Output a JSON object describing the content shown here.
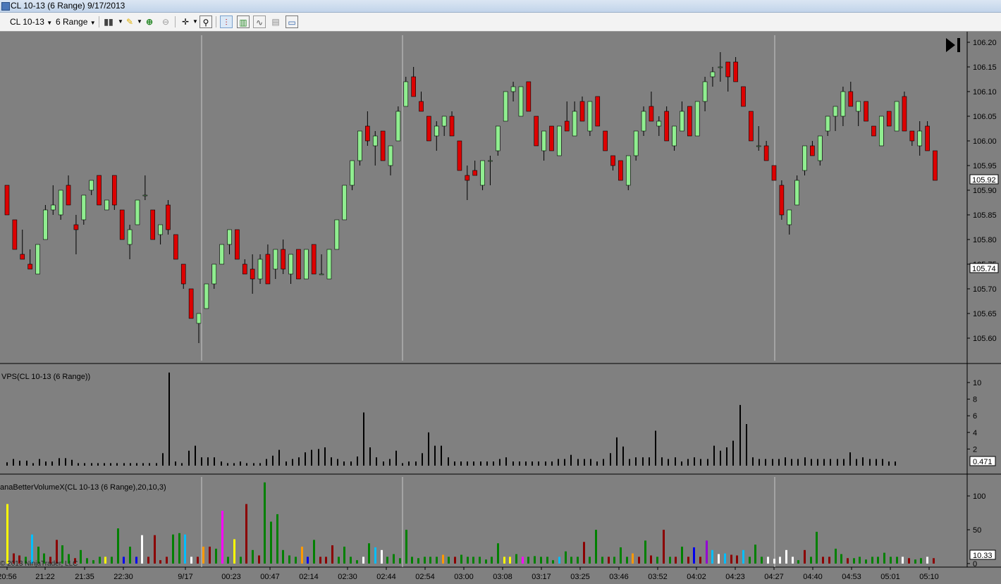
{
  "window": {
    "title": "CL 10-13 (6 Range)  9/17/2013"
  },
  "toolbar": {
    "instrument": "CL 10-13",
    "interval": "6 Range",
    "icons": [
      "bar-type-icon",
      "pencil-draw-icon",
      "zoom-in-icon",
      "zoom-out-icon",
      "crosshair-icon",
      "magnifier-icon",
      "bars-icon",
      "candles-icon",
      "line-chart-icon",
      "data-box-icon",
      "properties-icon"
    ]
  },
  "panels": {
    "price": {
      "y_labels": [
        "106.20",
        "106.15",
        "106.10",
        "106.05",
        "106.00",
        "105.95",
        "105.90",
        "105.85",
        "105.80",
        "105.75",
        "105.70",
        "105.65",
        "105.60"
      ],
      "last_price": "105.92",
      "marker_price": "105.74"
    },
    "vps": {
      "label": "VPS(CL 10-13 (6 Range))",
      "y_labels": [
        "10",
        "8",
        "6",
        "4",
        "2"
      ],
      "last_value": "0.471"
    },
    "bvx": {
      "label": "anaBetterVolumeX(CL 10-13 (6 Range),20,10,3)",
      "y_labels": [
        "100",
        "50",
        "0"
      ],
      "last_value": "10.33"
    }
  },
  "x_labels": [
    "20:56",
    "21:22",
    "21:35",
    "22:30",
    "9/17",
    "00:23",
    "00:47",
    "02:14",
    "02:30",
    "02:44",
    "02:54",
    "03:00",
    "03:08",
    "03:17",
    "03:25",
    "03:46",
    "03:52",
    "04:02",
    "04:23",
    "04:27",
    "04:40",
    "04:53",
    "05:01",
    "05:10"
  ],
  "copyright": "© 2013 NinjaTrader, LLC",
  "colors": {
    "up": "#90ee90",
    "down": "#dd0000",
    "background": "#808080"
  },
  "chart_data": {
    "type": "candlestick",
    "ylim": [
      105.55,
      106.23
    ],
    "candles": [
      {
        "o": 105.91,
        "h": 105.91,
        "l": 105.85,
        "c": 105.85
      },
      {
        "o": 105.84,
        "h": 105.84,
        "l": 105.78,
        "c": 105.78
      },
      {
        "o": 105.77,
        "h": 105.82,
        "l": 105.76,
        "c": 105.76
      },
      {
        "o": 105.75,
        "h": 105.78,
        "l": 105.74,
        "c": 105.74
      },
      {
        "o": 105.73,
        "h": 105.79,
        "l": 105.73,
        "c": 105.79
      },
      {
        "o": 105.8,
        "h": 105.87,
        "l": 105.8,
        "c": 105.86
      },
      {
        "o": 105.86,
        "h": 105.91,
        "l": 105.85,
        "c": 105.87
      },
      {
        "o": 105.85,
        "h": 105.9,
        "l": 105.84,
        "c": 105.9
      },
      {
        "o": 105.91,
        "h": 105.93,
        "l": 105.87,
        "c": 105.87
      },
      {
        "o": 105.83,
        "h": 105.85,
        "l": 105.77,
        "c": 105.82
      },
      {
        "o": 105.84,
        "h": 105.89,
        "l": 105.83,
        "c": 105.89
      },
      {
        "o": 105.9,
        "h": 105.92,
        "l": 105.89,
        "c": 105.92
      },
      {
        "o": 105.93,
        "h": 105.93,
        "l": 105.87,
        "c": 105.87
      },
      {
        "o": 105.86,
        "h": 105.88,
        "l": 105.86,
        "c": 105.88
      },
      {
        "o": 105.93,
        "h": 105.93,
        "l": 105.86,
        "c": 105.87
      },
      {
        "o": 105.86,
        "h": 105.86,
        "l": 105.8,
        "c": 105.8
      },
      {
        "o": 105.79,
        "h": 105.83,
        "l": 105.76,
        "c": 105.82
      },
      {
        "o": 105.83,
        "h": 105.88,
        "l": 105.83,
        "c": 105.88
      },
      {
        "o": 105.89,
        "h": 105.93,
        "l": 105.88,
        "c": 105.89
      },
      {
        "o": 105.86,
        "h": 105.86,
        "l": 105.8,
        "c": 105.8
      },
      {
        "o": 105.81,
        "h": 105.83,
        "l": 105.79,
        "c": 105.83
      },
      {
        "o": 105.87,
        "h": 105.88,
        "l": 105.81,
        "c": 105.82
      },
      {
        "o": 105.81,
        "h": 105.81,
        "l": 105.76,
        "c": 105.76
      },
      {
        "o": 105.75,
        "h": 105.75,
        "l": 105.7,
        "c": 105.71
      },
      {
        "o": 105.7,
        "h": 105.7,
        "l": 105.64,
        "c": 105.64
      },
      {
        "o": 105.63,
        "h": 105.65,
        "l": 105.59,
        "c": 105.65
      },
      {
        "o": 105.66,
        "h": 105.71,
        "l": 105.66,
        "c": 105.71
      },
      {
        "o": 105.71,
        "h": 105.75,
        "l": 105.7,
        "c": 105.75
      },
      {
        "o": 105.75,
        "h": 105.79,
        "l": 105.75,
        "c": 105.79
      },
      {
        "o": 105.79,
        "h": 105.82,
        "l": 105.77,
        "c": 105.82
      },
      {
        "o": 105.82,
        "h": 105.82,
        "l": 105.76,
        "c": 105.76
      },
      {
        "o": 105.75,
        "h": 105.76,
        "l": 105.73,
        "c": 105.73
      },
      {
        "o": 105.74,
        "h": 105.77,
        "l": 105.69,
        "c": 105.72
      },
      {
        "o": 105.72,
        "h": 105.77,
        "l": 105.71,
        "c": 105.76
      },
      {
        "o": 105.77,
        "h": 105.79,
        "l": 105.71,
        "c": 105.71
      },
      {
        "o": 105.74,
        "h": 105.78,
        "l": 105.72,
        "c": 105.78
      },
      {
        "o": 105.78,
        "h": 105.8,
        "l": 105.73,
        "c": 105.74
      },
      {
        "o": 105.73,
        "h": 105.77,
        "l": 105.71,
        "c": 105.77
      },
      {
        "o": 105.78,
        "h": 105.78,
        "l": 105.72,
        "c": 105.72
      },
      {
        "o": 105.72,
        "h": 105.78,
        "l": 105.72,
        "c": 105.78
      },
      {
        "o": 105.79,
        "h": 105.79,
        "l": 105.73,
        "c": 105.73
      },
      {
        "o": 105.73,
        "h": 105.77,
        "l": 105.73,
        "c": 105.73
      },
      {
        "o": 105.72,
        "h": 105.78,
        "l": 105.72,
        "c": 105.78
      },
      {
        "o": 105.78,
        "h": 105.84,
        "l": 105.78,
        "c": 105.84
      },
      {
        "o": 105.84,
        "h": 105.91,
        "l": 105.84,
        "c": 105.91
      },
      {
        "o": 105.91,
        "h": 105.96,
        "l": 105.9,
        "c": 105.96
      },
      {
        "o": 105.96,
        "h": 106.02,
        "l": 105.95,
        "c": 106.02
      },
      {
        "o": 106.03,
        "h": 106.06,
        "l": 105.99,
        "c": 106.0
      },
      {
        "o": 105.99,
        "h": 106.02,
        "l": 105.95,
        "c": 106.01
      },
      {
        "o": 106.02,
        "h": 106.02,
        "l": 105.96,
        "c": 105.96
      },
      {
        "o": 105.95,
        "h": 105.99,
        "l": 105.93,
        "c": 105.99
      },
      {
        "o": 106.0,
        "h": 106.07,
        "l": 106.0,
        "c": 106.06
      },
      {
        "o": 106.07,
        "h": 106.13,
        "l": 106.07,
        "c": 106.12
      },
      {
        "o": 106.13,
        "h": 106.15,
        "l": 106.09,
        "c": 106.09
      },
      {
        "o": 106.08,
        "h": 106.1,
        "l": 106.06,
        "c": 106.06
      },
      {
        "o": 106.05,
        "h": 106.05,
        "l": 106.0,
        "c": 106.0
      },
      {
        "o": 106.01,
        "h": 106.04,
        "l": 105.98,
        "c": 106.03
      },
      {
        "o": 106.03,
        "h": 106.05,
        "l": 106.01,
        "c": 106.05
      },
      {
        "o": 106.05,
        "h": 106.06,
        "l": 106.01,
        "c": 106.01
      },
      {
        "o": 106.0,
        "h": 106.0,
        "l": 105.94,
        "c": 105.94
      },
      {
        "o": 105.93,
        "h": 105.95,
        "l": 105.88,
        "c": 105.92
      },
      {
        "o": 105.94,
        "h": 105.96,
        "l": 105.93,
        "c": 105.93
      },
      {
        "o": 105.91,
        "h": 105.96,
        "l": 105.9,
        "c": 105.96
      },
      {
        "o": 105.96,
        "h": 105.97,
        "l": 105.91,
        "c": 105.96
      },
      {
        "o": 105.98,
        "h": 106.03,
        "l": 105.97,
        "c": 106.03
      },
      {
        "o": 106.04,
        "h": 106.1,
        "l": 106.04,
        "c": 106.1
      },
      {
        "o": 106.1,
        "h": 106.12,
        "l": 106.08,
        "c": 106.11
      },
      {
        "o": 106.05,
        "h": 106.11,
        "l": 106.05,
        "c": 106.11
      },
      {
        "o": 106.12,
        "h": 106.12,
        "l": 106.06,
        "c": 106.06
      },
      {
        "o": 106.05,
        "h": 106.05,
        "l": 105.99,
        "c": 105.99
      },
      {
        "o": 105.98,
        "h": 106.02,
        "l": 105.96,
        "c": 106.02
      },
      {
        "o": 106.03,
        "h": 106.03,
        "l": 105.98,
        "c": 105.98
      },
      {
        "o": 105.97,
        "h": 106.03,
        "l": 105.97,
        "c": 106.03
      },
      {
        "o": 106.04,
        "h": 106.08,
        "l": 106.02,
        "c": 106.02
      },
      {
        "o": 106.01,
        "h": 106.08,
        "l": 106.01,
        "c": 106.06
      },
      {
        "o": 106.08,
        "h": 106.09,
        "l": 106.04,
        "c": 106.04
      },
      {
        "o": 106.02,
        "h": 106.08,
        "l": 106.01,
        "c": 106.08
      },
      {
        "o": 106.09,
        "h": 106.09,
        "l": 106.03,
        "c": 106.03
      },
      {
        "o": 106.02,
        "h": 106.02,
        "l": 105.98,
        "c": 105.98
      },
      {
        "o": 105.97,
        "h": 105.97,
        "l": 105.94,
        "c": 105.95
      },
      {
        "o": 105.96,
        "h": 105.96,
        "l": 105.92,
        "c": 105.92
      },
      {
        "o": 105.91,
        "h": 105.97,
        "l": 105.9,
        "c": 105.97
      },
      {
        "o": 105.97,
        "h": 106.02,
        "l": 105.96,
        "c": 106.02
      },
      {
        "o": 106.02,
        "h": 106.07,
        "l": 106.01,
        "c": 106.06
      },
      {
        "o": 106.07,
        "h": 106.1,
        "l": 106.04,
        "c": 106.04
      },
      {
        "o": 106.03,
        "h": 106.05,
        "l": 106.01,
        "c": 106.04
      },
      {
        "o": 106.06,
        "h": 106.07,
        "l": 106.0,
        "c": 106.0
      },
      {
        "o": 105.99,
        "h": 106.03,
        "l": 105.98,
        "c": 106.03
      },
      {
        "o": 106.02,
        "h": 106.08,
        "l": 106.02,
        "c": 106.06
      },
      {
        "o": 106.07,
        "h": 106.07,
        "l": 106.01,
        "c": 106.01
      },
      {
        "o": 106.01,
        "h": 106.08,
        "l": 106.01,
        "c": 106.08
      },
      {
        "o": 106.08,
        "h": 106.13,
        "l": 106.06,
        "c": 106.12
      },
      {
        "o": 106.13,
        "h": 106.15,
        "l": 106.11,
        "c": 106.14
      },
      {
        "o": 106.15,
        "h": 106.18,
        "l": 106.12,
        "c": 106.15
      },
      {
        "o": 106.16,
        "h": 106.16,
        "l": 106.1,
        "c": 106.13
      },
      {
        "o": 106.16,
        "h": 106.17,
        "l": 106.12,
        "c": 106.12
      },
      {
        "o": 106.11,
        "h": 106.11,
        "l": 106.07,
        "c": 106.07
      },
      {
        "o": 106.06,
        "h": 106.06,
        "l": 106.0,
        "c": 106.0
      },
      {
        "o": 105.99,
        "h": 106.03,
        "l": 105.98,
        "c": 105.99
      },
      {
        "o": 105.99,
        "h": 106.0,
        "l": 105.96,
        "c": 105.96
      },
      {
        "o": 105.95,
        "h": 105.95,
        "l": 105.92,
        "c": 105.92
      },
      {
        "o": 105.91,
        "h": 105.92,
        "l": 105.84,
        "c": 105.85
      },
      {
        "o": 105.83,
        "h": 105.86,
        "l": 105.81,
        "c": 105.86
      },
      {
        "o": 105.87,
        "h": 105.93,
        "l": 105.87,
        "c": 105.92
      },
      {
        "o": 105.94,
        "h": 105.99,
        "l": 105.93,
        "c": 105.99
      },
      {
        "o": 105.99,
        "h": 106.0,
        "l": 105.97,
        "c": 105.97
      },
      {
        "o": 105.96,
        "h": 106.01,
        "l": 105.95,
        "c": 106.01
      },
      {
        "o": 106.02,
        "h": 106.05,
        "l": 106.01,
        "c": 106.05
      },
      {
        "o": 106.05,
        "h": 106.07,
        "l": 106.02,
        "c": 106.07
      },
      {
        "o": 106.05,
        "h": 106.11,
        "l": 106.03,
        "c": 106.1
      },
      {
        "o": 106.1,
        "h": 106.12,
        "l": 106.07,
        "c": 106.07
      },
      {
        "o": 106.06,
        "h": 106.08,
        "l": 106.03,
        "c": 106.08
      },
      {
        "o": 106.08,
        "h": 106.08,
        "l": 106.04,
        "c": 106.04
      },
      {
        "o": 106.03,
        "h": 106.03,
        "l": 106.01,
        "c": 106.01
      },
      {
        "o": 105.99,
        "h": 106.05,
        "l": 105.99,
        "c": 106.05
      },
      {
        "o": 106.06,
        "h": 106.06,
        "l": 106.03,
        "c": 106.03
      },
      {
        "o": 106.02,
        "h": 106.08,
        "l": 106.02,
        "c": 106.08
      },
      {
        "o": 106.09,
        "h": 106.1,
        "l": 106.02,
        "c": 106.02
      },
      {
        "o": 106.02,
        "h": 106.02,
        "l": 105.99,
        "c": 106.0
      },
      {
        "o": 105.99,
        "h": 106.04,
        "l": 105.97,
        "c": 106.02
      },
      {
        "o": 106.03,
        "h": 106.04,
        "l": 105.98,
        "c": 105.98
      },
      {
        "o": 105.98,
        "h": 105.98,
        "l": 105.92,
        "c": 105.92
      }
    ],
    "vps_values": [
      0.4,
      0.8,
      0.6,
      0.6,
      0.3,
      0.8,
      0.5,
      0.5,
      0.9,
      0.9,
      0.7,
      0.3,
      0.3,
      0.3,
      0.3,
      0.3,
      0.3,
      0.3,
      0.3,
      0.3,
      0.3,
      0.3,
      0.3,
      0.3,
      1.5,
      11.2,
      0.5,
      0.3,
      1.8,
      2.4,
      1.0,
      1.0,
      1.0,
      0.5,
      0.3,
      0.3,
      0.5,
      0.3,
      0.3,
      0.3,
      0.8,
      1.2,
      1.9,
      0.5,
      0.8,
      1.0,
      1.6,
      1.9,
      2.0,
      2.2,
      1.0,
      0.8,
      0.5,
      0.5,
      1.1,
      6.4,
      2.2,
      1.0,
      0.5,
      0.8,
      1.8,
      0.3,
      0.5,
      0.5,
      1.5,
      4.0,
      2.4,
      2.4,
      1.0,
      0.5,
      0.5,
      0.5,
      0.5,
      0.5,
      0.5,
      0.5,
      0.8,
      1.0,
      0.5,
      0.5,
      0.5,
      0.5,
      0.5,
      0.5,
      0.5,
      0.8,
      0.8,
      1.3,
      0.8,
      0.8,
      0.8,
      0.5,
      0.8,
      1.5,
      3.4,
      2.3,
      0.8,
      1.0,
      1.0,
      1.0,
      4.2,
      1.0,
      0.8,
      1.0,
      0.5,
      0.8,
      1.0,
      0.8,
      0.8,
      2.4,
      1.8,
      2.2,
      3.0,
      7.3,
      5.0,
      1.0,
      0.8,
      0.8,
      0.8,
      0.8,
      1.0,
      0.8,
      0.8,
      1.0,
      0.8,
      0.8,
      0.8,
      0.8,
      0.8,
      0.8,
      1.6,
      0.8,
      1.0,
      0.8,
      0.8,
      0.8,
      0.5,
      0.5
    ],
    "bvx_values": [
      88,
      15,
      12,
      10,
      43,
      25,
      15,
      10,
      35,
      27,
      14,
      8,
      20,
      8,
      5,
      10,
      10,
      10,
      52,
      10,
      25,
      10,
      42,
      10,
      42,
      5,
      10,
      43,
      45,
      43,
      10,
      10,
      25,
      25,
      22,
      78,
      10,
      36,
      10,
      88,
      20,
      12,
      120,
      62,
      73,
      20,
      12,
      10,
      25,
      10,
      35,
      10,
      10,
      27,
      10,
      25,
      10,
      5,
      10,
      30,
      24,
      20,
      10,
      14,
      8,
      50,
      10,
      8,
      10,
      10,
      10,
      13,
      10,
      10,
      13,
      10,
      10,
      10,
      6,
      10,
      30,
      10,
      10,
      14,
      10,
      10,
      11,
      10,
      10,
      5,
      10,
      18,
      10,
      10,
      32,
      10,
      50,
      10,
      10,
      10,
      24,
      10,
      15,
      10,
      34,
      12,
      10,
      50,
      10,
      10,
      25,
      10,
      24,
      10,
      34,
      20,
      14,
      15,
      13,
      12,
      20,
      10,
      28,
      10,
      10,
      7,
      10,
      20,
      10,
      5,
      20,
      10,
      47,
      10,
      10,
      22,
      14,
      8,
      8,
      10,
      6,
      10,
      10,
      16,
      10,
      10,
      10,
      8,
      6,
      8,
      10,
      8
    ],
    "bvx_colors": [
      "yellow",
      "darkred",
      "darkred",
      "green",
      "cyan",
      "green",
      "green",
      "darkred",
      "darkred",
      "green",
      "green",
      "darkred",
      "green",
      "green",
      "green",
      "green",
      "yellow",
      "green",
      "green",
      "blue",
      "green",
      "blue",
      "white",
      "darkred",
      "darkred",
      "darkred",
      "darkred",
      "green",
      "green",
      "cyan",
      "white",
      "darkred",
      "orange",
      "darkred",
      "green",
      "magenta",
      "green",
      "yellow",
      "green",
      "darkred",
      "green",
      "darkred",
      "green",
      "green",
      "green",
      "green",
      "green",
      "green",
      "orange",
      "blue",
      "green",
      "darkred",
      "darkred",
      "darkred",
      "green",
      "green",
      "green",
      "green",
      "white",
      "green",
      "cyan",
      "white",
      "green",
      "green",
      "green",
      "green",
      "green",
      "green",
      "green",
      "green",
      "green",
      "orange",
      "green",
      "darkred",
      "green",
      "green",
      "green",
      "green",
      "green",
      "green",
      "green",
      "yellow",
      "yellow",
      "green",
      "magenta",
      "green",
      "green",
      "green",
      "green",
      "green",
      "cyan",
      "green",
      "green",
      "green",
      "darkred",
      "green",
      "green",
      "green",
      "darkred",
      "green",
      "green",
      "green",
      "orange",
      "darkred",
      "green",
      "darkred",
      "green",
      "darkred",
      "green",
      "darkred",
      "green",
      "darkred",
      "blue",
      "darkred",
      "purple",
      "cyan",
      "white",
      "cyan",
      "darkred",
      "darkred",
      "cyan",
      "green",
      "green",
      "green",
      "white",
      "white",
      "white",
      "white",
      "white",
      "green",
      "darkred",
      "green",
      "green",
      "darkred",
      "darkred",
      "green",
      "green",
      "darkred",
      "green",
      "green",
      "green",
      "green",
      "green",
      "green",
      "green",
      "green",
      "white",
      "darkred",
      "green",
      "green",
      "white",
      "darkred"
    ]
  }
}
